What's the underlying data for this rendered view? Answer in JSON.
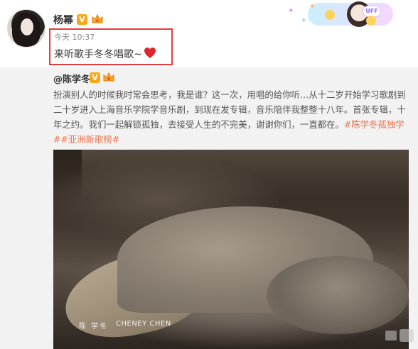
{
  "post": {
    "username": "杨幂",
    "vip_mark": "V",
    "timestamp": "今天 10:37",
    "text": "来听歌手冬冬唱歌~",
    "banner_badge": "UFF"
  },
  "repost": {
    "author": "@陈学冬",
    "vip_mark": "V",
    "body": "扮演别人的时候我时常会思考，我是谁？这一次，用唱的给你听…从十二岁开始学习歌剧到二十岁进入上海音乐学院学音乐剧，到现在发专辑，音乐陪伴我整整十八年。首张专辑，十年之约。我们一起解锁孤独，去接受人生的不完美，谢谢你们，一直都在。",
    "hashtag_1": "#陈学冬孤独学#",
    "hashtag_2": "#亚洲新歌榜#"
  },
  "video": {
    "caption_cn": "陈 学冬",
    "caption_en": "CHENEY CHEN"
  },
  "colors": {
    "highlight": "#e83a3a",
    "hashtag": "#eb7350",
    "vip": "#f7a81c",
    "heart": "#e0242a"
  },
  "icons": [
    "avatar",
    "vip-icon",
    "crown-icon",
    "heart-icon",
    "banner-decoration",
    "watermark-icon"
  ]
}
